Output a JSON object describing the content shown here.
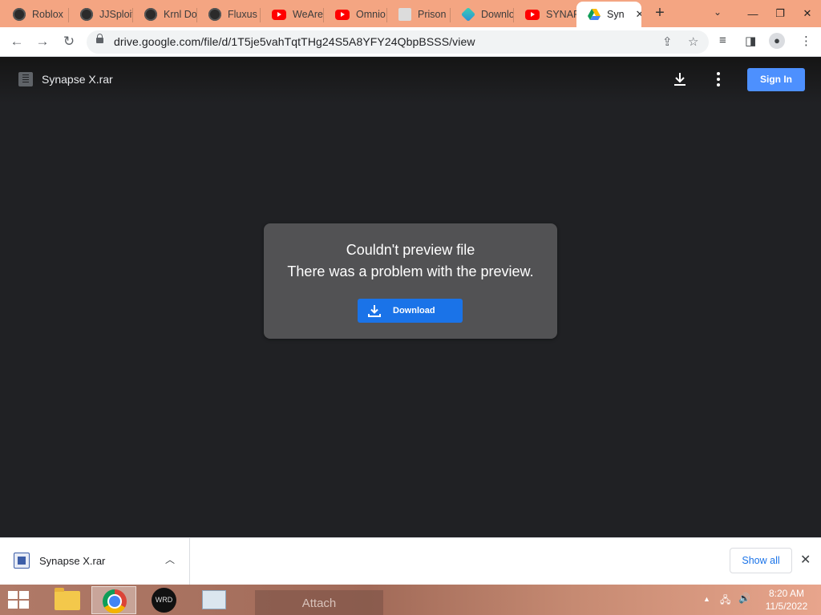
{
  "tabs": [
    {
      "title": "Roblox",
      "icon": "roblox-icon"
    },
    {
      "title": "JJSploit",
      "icon": "roblox-icon"
    },
    {
      "title": "Krnl Do",
      "icon": "roblox-icon"
    },
    {
      "title": "Fluxus",
      "icon": "roblox-icon"
    },
    {
      "title": "WeAre",
      "icon": "youtube-icon"
    },
    {
      "title": "Omnio",
      "icon": "youtube-icon"
    },
    {
      "title": "Prison",
      "icon": "document-icon"
    },
    {
      "title": "Downlo",
      "icon": "gem-icon"
    },
    {
      "title": "SYNAP",
      "icon": "youtube-icon"
    },
    {
      "title": "Syn",
      "icon": "google-drive-icon"
    }
  ],
  "address_bar": {
    "url": "drive.google.com/file/d/1T5je5vahTqtTHg24S5A8YFY24QbpBSSS/view"
  },
  "viewer": {
    "file_name": "Synapse X.rar",
    "sign_in_label": "Sign In"
  },
  "error_card": {
    "title": "Couldn't preview file",
    "message": "There was a problem with the preview.",
    "download_label": "Download"
  },
  "download_shelf": {
    "file_name": "Synapse X.rar",
    "show_all_label": "Show all"
  },
  "taskbar": {
    "attach_label": "Attach",
    "time": "8:20 AM",
    "date": "11/5/2022"
  },
  "colors": {
    "accent_blue": "#1a73e8",
    "signin_blue": "#4d90fe",
    "card_bg": "#525254",
    "viewer_bg": "#202124",
    "tabstrip_bg": "#f4a582"
  }
}
